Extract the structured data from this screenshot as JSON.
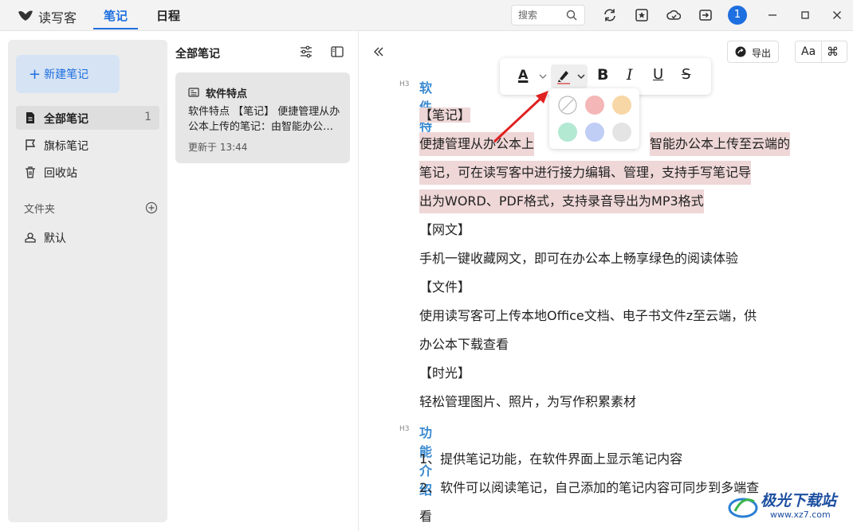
{
  "app": {
    "name": "读写客"
  },
  "tabs": [
    {
      "label": "笔记"
    },
    {
      "label": "日程"
    }
  ],
  "search": {
    "placeholder": "搜索"
  },
  "user": {
    "avatar_text": "1"
  },
  "sidebar": {
    "new_note": "新建笔记",
    "items": [
      {
        "label": "全部笔记",
        "count": "1"
      },
      {
        "label": "旗标笔记"
      },
      {
        "label": "回收站"
      }
    ],
    "folder_header": "文件夹",
    "folders": [
      {
        "label": "默认"
      }
    ]
  },
  "note_list": {
    "title": "全部笔记",
    "notes": [
      {
        "title": "软件特点",
        "excerpt": "软件特点 【笔记】 便捷管理从办公本上传的笔记：由智能办公本上传至云端的笔记",
        "updated": "更新于 13:44"
      }
    ]
  },
  "editor": {
    "export_label": "导出",
    "font_label": "Aa",
    "cmd_label": "⌘",
    "h3_tag": "H3",
    "heading1": "软件特点",
    "lines": [
      "【笔记】",
      "便捷管理从办公本上",
      "智能办公本上传至云端的",
      "笔记，可在读写客中进行接力编辑、管理，支持手写笔记导",
      "出为WORD、PDF格式，支持录音导出为MP3格式",
      "【网文】",
      "手机一键收藏网文，即可在办公本上畅享绿色的阅读体验",
      "【文件】",
      "使用读写客可上传本地Office文档、电子书文件z至云端，供",
      "办公本下载查看",
      "【时光】",
      "轻松管理图片、照片，为写作积累素材"
    ],
    "heading2": "功能介绍",
    "lines2": [
      "1、提供笔记功能，在软件界面上显示笔记内容",
      "2、软件可以阅读笔记，自己添加的笔记内容可同步到多端查",
      "看"
    ]
  },
  "format_toolbar": {
    "font_color_label": "A",
    "bold": "B",
    "italic": "I",
    "underline": "U",
    "strike": "S",
    "highlight_colors": [
      "none",
      "#f4b6b6",
      "#f8d7a6",
      "#b3e8d2",
      "#c0cdf5",
      "#e4e4e4"
    ]
  },
  "watermark": {
    "text": "极光下载站",
    "url": "www.xz7.com"
  }
}
